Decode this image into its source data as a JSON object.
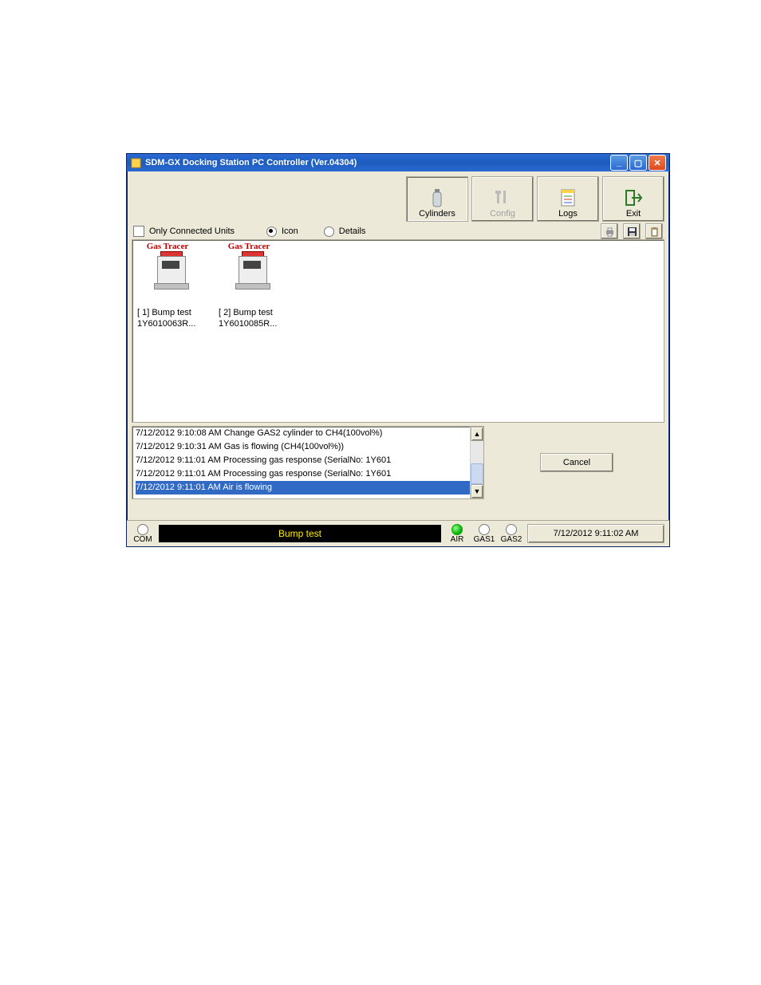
{
  "window": {
    "title": "SDM-GX Docking Station PC Controller (Ver.04304)"
  },
  "toolbar": {
    "cylinders": "Cylinders",
    "config": "Config",
    "logs": "Logs",
    "exit": "Exit"
  },
  "filters": {
    "only_connected": "Only Connected Units",
    "icon": "Icon",
    "details": "Details",
    "view_mode": "Icon"
  },
  "units": [
    {
      "brand": "Gas Tracer",
      "line1": "[ 1] Bump test",
      "line2": "1Y6010063R..."
    },
    {
      "brand": "Gas Tracer",
      "line1": "[ 2] Bump test",
      "line2": "1Y6010085R..."
    }
  ],
  "log": {
    "entries": [
      "7/12/2012 9:10:08 AM Change GAS2 cylinder to CH4(100vol%)",
      "7/12/2012 9:10:31 AM Gas is flowing (CH4(100vol%))",
      "7/12/2012 9:11:01 AM Processing gas response (SerialNo: 1Y601",
      "7/12/2012 9:11:01 AM Processing gas response (SerialNo: 1Y601",
      "7/12/2012 9:11:01 AM Air is flowing"
    ],
    "selected_index": 4
  },
  "actions": {
    "cancel": "Cancel"
  },
  "status": {
    "com_label": "COM",
    "message": "Bump test",
    "air_label": "AIR",
    "gas1_label": "GAS1",
    "gas2_label": "GAS2",
    "air_on": true,
    "gas1_on": false,
    "gas2_on": false,
    "clock": "7/12/2012 9:11:02 AM"
  }
}
